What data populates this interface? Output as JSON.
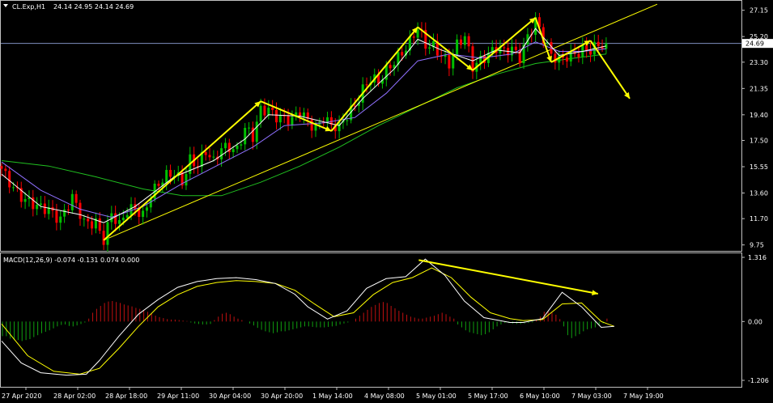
{
  "window": {
    "symbol_label": "CL.Exp,H1",
    "ohlc_label": "24.14 24.95 24.14 24.69",
    "current_price_label": "24.69"
  },
  "colors": {
    "background": "#000000",
    "axis_line": "#c0c0c0",
    "text": "#ffffff",
    "bull_candle": "#00c000",
    "bear_candle": "#ff0000",
    "ema_fast": "#ffffff",
    "ema_slow": "#9070ff",
    "sma_long": "#20c020",
    "trendline": "#ffff00",
    "price_line": "#7f8fbf",
    "macd_line": "#ffffff",
    "signal_line": "#ffff00",
    "hist_pos": "#c01010",
    "hist_neg": "#10a010",
    "annotation": "#ffff00"
  },
  "chart_data": [
    {
      "type": "candlestick",
      "title": "CL.Exp,H1",
      "ylim": [
        9.55,
        27.55
      ],
      "y_ticks": [
        "27.15",
        "25.20",
        "23.30",
        "21.35",
        "19.40",
        "17.50",
        "15.55",
        "13.60",
        "11.70",
        "9.75"
      ],
      "x_ticks": [
        "27 Apr 2020",
        "28 Apr 02:00",
        "28 Apr 18:00",
        "29 Apr 11:00",
        "30 Apr 04:00",
        "30 Apr 20:00",
        "1 May 14:00",
        "4 May 08:00",
        "5 May 01:00",
        "5 May 17:00",
        "6 May 10:00",
        "7 May 03:00",
        "7 May 19:00"
      ],
      "bar_count": 155,
      "last_price": 24.69,
      "close_path": [
        [
          0,
          15.4
        ],
        [
          3,
          14.2
        ],
        [
          6,
          13.0
        ],
        [
          9,
          12.4
        ],
        [
          12,
          12.5
        ],
        [
          15,
          11.8
        ],
        [
          18,
          13.1
        ],
        [
          21,
          11.3
        ],
        [
          24,
          11.6
        ],
        [
          26,
          10.3
        ],
        [
          28,
          12.0
        ],
        [
          30,
          11.0
        ],
        [
          32,
          12.2
        ],
        [
          34,
          12.6
        ],
        [
          36,
          12.1
        ],
        [
          38,
          13.5
        ],
        [
          40,
          14.1
        ],
        [
          42,
          14.7
        ],
        [
          44,
          15.1
        ],
        [
          46,
          14.6
        ],
        [
          48,
          16.2
        ],
        [
          50,
          15.6
        ],
        [
          52,
          16.5
        ],
        [
          54,
          15.8
        ],
        [
          56,
          17.1
        ],
        [
          58,
          17.2
        ],
        [
          60,
          16.8
        ],
        [
          62,
          18.2
        ],
        [
          64,
          17.6
        ],
        [
          66,
          19.8
        ],
        [
          68,
          20.0
        ],
        [
          70,
          19.4
        ],
        [
          72,
          19.0
        ],
        [
          74,
          18.8
        ],
        [
          76,
          19.6
        ],
        [
          78,
          19.1
        ],
        [
          80,
          18.6
        ],
        [
          82,
          19.2
        ],
        [
          84,
          18.4
        ],
        [
          86,
          18.3
        ],
        [
          88,
          19.4
        ],
        [
          90,
          20.3
        ],
        [
          92,
          21.4
        ],
        [
          94,
          22.0
        ],
        [
          96,
          21.6
        ],
        [
          98,
          22.6
        ],
        [
          100,
          23.5
        ],
        [
          102,
          24.2
        ],
        [
          104,
          24.8
        ],
        [
          106,
          25.7
        ],
        [
          108,
          24.4
        ],
        [
          110,
          24.5
        ],
        [
          112,
          24.0
        ],
        [
          114,
          23.3
        ],
        [
          116,
          24.5
        ],
        [
          118,
          25.0
        ],
        [
          120,
          22.9
        ],
        [
          122,
          23.6
        ],
        [
          124,
          24.1
        ],
        [
          126,
          24.4
        ],
        [
          128,
          23.9
        ],
        [
          130,
          24.1
        ],
        [
          132,
          23.7
        ],
        [
          134,
          25.4
        ],
        [
          136,
          26.5
        ],
        [
          138,
          25.0
        ],
        [
          140,
          23.6
        ],
        [
          142,
          23.4
        ],
        [
          144,
          23.9
        ],
        [
          146,
          24.1
        ],
        [
          148,
          24.2
        ],
        [
          150,
          24.0
        ],
        [
          152,
          24.4
        ],
        [
          154,
          24.69
        ]
      ],
      "indicators": [
        {
          "name": "ema_fast",
          "colorKey": "ema_fast",
          "path": [
            [
              0,
              15.0
            ],
            [
              10,
              12.6
            ],
            [
              20,
              12.0
            ],
            [
              26,
              11.4
            ],
            [
              34,
              12.6
            ],
            [
              44,
              14.8
            ],
            [
              54,
              16.0
            ],
            [
              62,
              17.6
            ],
            [
              68,
              19.4
            ],
            [
              76,
              19.3
            ],
            [
              86,
              18.6
            ],
            [
              92,
              20.6
            ],
            [
              100,
              22.8
            ],
            [
              106,
              25.0
            ],
            [
              112,
              24.2
            ],
            [
              120,
              23.4
            ],
            [
              126,
              24.2
            ],
            [
              132,
              24.0
            ],
            [
              136,
              25.8
            ],
            [
              142,
              23.8
            ],
            [
              148,
              24.1
            ],
            [
              154,
              24.5
            ]
          ]
        },
        {
          "name": "ema_slow",
          "colorKey": "ema_slow",
          "path": [
            [
              0,
              15.9
            ],
            [
              10,
              13.8
            ],
            [
              20,
              12.4
            ],
            [
              28,
              11.8
            ],
            [
              36,
              12.6
            ],
            [
              46,
              14.3
            ],
            [
              56,
              15.8
            ],
            [
              64,
              17.0
            ],
            [
              72,
              18.6
            ],
            [
              82,
              18.8
            ],
            [
              90,
              19.2
            ],
            [
              98,
              21.0
            ],
            [
              106,
              23.4
            ],
            [
              114,
              23.9
            ],
            [
              122,
              23.6
            ],
            [
              130,
              23.9
            ],
            [
              136,
              24.8
            ],
            [
              142,
              24.1
            ],
            [
              148,
              24.1
            ],
            [
              154,
              24.3
            ]
          ]
        },
        {
          "name": "sma_long",
          "colorKey": "sma_long",
          "path": [
            [
              0,
              16.0
            ],
            [
              12,
              15.6
            ],
            [
              24,
              14.8
            ],
            [
              36,
              13.9
            ],
            [
              46,
              13.4
            ],
            [
              56,
              13.4
            ],
            [
              66,
              14.4
            ],
            [
              76,
              15.6
            ],
            [
              86,
              17.0
            ],
            [
              96,
              18.6
            ],
            [
              106,
              20.0
            ],
            [
              116,
              21.4
            ],
            [
              126,
              22.4
            ],
            [
              136,
              23.2
            ],
            [
              146,
              23.6
            ],
            [
              154,
              23.9
            ]
          ]
        }
      ],
      "trendlines": [
        {
          "name": "support-trendline",
          "from": [
            26,
            10.1
          ],
          "to": [
            167,
            27.6
          ]
        }
      ],
      "annotations": {
        "zigzag": [
          [
            26,
            10.1
          ],
          [
            66,
            20.4
          ],
          [
            84,
            18.2
          ],
          [
            106,
            25.9
          ],
          [
            120,
            22.7
          ],
          [
            136,
            26.6
          ],
          [
            140,
            23.3
          ],
          [
            150,
            24.9
          ]
        ],
        "projection": {
          "from": [
            150,
            24.9
          ],
          "to": [
            160,
            20.6
          ]
        }
      }
    },
    {
      "type": "macd",
      "title": "MACD(12,26,9) -0.074 -0.131 0.074 0.000",
      "ylim": [
        -1.206,
        1.316
      ],
      "y_ticks": [
        "1.316",
        "0.00",
        "-1.206"
      ],
      "histogram": [
        -0.3,
        -0.3,
        -0.35,
        -0.38,
        -0.38,
        -0.4,
        -0.38,
        -0.36,
        -0.32,
        -0.28,
        -0.24,
        -0.21,
        -0.18,
        -0.14,
        -0.1,
        -0.07,
        -0.06,
        -0.09,
        -0.1,
        -0.08,
        -0.05,
        -0.02,
        0.06,
        0.18,
        0.26,
        0.32,
        0.38,
        0.41,
        0.42,
        0.4,
        0.38,
        0.35,
        0.33,
        0.31,
        0.28,
        0.26,
        0.24,
        0.2,
        0.16,
        0.12,
        0.09,
        0.07,
        0.05,
        0.04,
        0.04,
        0.03,
        0.02,
        0.01,
        -0.02,
        -0.04,
        -0.05,
        -0.06,
        -0.06,
        -0.05,
        0.03,
        0.1,
        0.16,
        0.18,
        0.15,
        0.1,
        0.06,
        0.03,
        0.0,
        -0.04,
        -0.08,
        -0.13,
        -0.17,
        -0.2,
        -0.22,
        -0.24,
        -0.22,
        -0.2,
        -0.2,
        -0.18,
        -0.16,
        -0.14,
        -0.12,
        -0.1,
        -0.1,
        -0.11,
        -0.12,
        -0.12,
        -0.12,
        -0.11,
        -0.1,
        -0.09,
        -0.06,
        -0.04,
        -0.02,
        0.0,
        0.06,
        0.12,
        0.18,
        0.24,
        0.3,
        0.34,
        0.38,
        0.4,
        0.38,
        0.32,
        0.27,
        0.22,
        0.18,
        0.14,
        0.1,
        0.08,
        0.06,
        0.06,
        0.08,
        0.1,
        0.12,
        0.15,
        0.18,
        0.15,
        0.1,
        0.06,
        -0.06,
        -0.12,
        -0.18,
        -0.22,
        -0.24,
        -0.26,
        -0.28,
        -0.26,
        -0.22,
        -0.16,
        -0.1,
        -0.06,
        -0.03,
        -0.03,
        -0.04,
        -0.05,
        -0.05,
        -0.04,
        -0.03,
        -0.02,
        0.03,
        0.1,
        0.2,
        0.22,
        0.18,
        0.14,
        0.05,
        -0.1,
        -0.28,
        -0.34,
        -0.3,
        -0.26,
        -0.2,
        -0.16,
        -0.14,
        -0.12,
        -0.08,
        -0.04,
        0.06
      ],
      "series": [
        {
          "name": "macd",
          "colorKey": "macd_line",
          "path": [
            [
              0,
              -0.4
            ],
            [
              6,
              -0.85
            ],
            [
              12,
              -1.05
            ],
            [
              20,
              -1.1
            ],
            [
              26,
              -1.08
            ],
            [
              30,
              -0.8
            ],
            [
              36,
              -0.3
            ],
            [
              42,
              0.15
            ],
            [
              48,
              0.45
            ],
            [
              54,
              0.7
            ],
            [
              60,
              0.82
            ],
            [
              66,
              0.88
            ],
            [
              72,
              0.9
            ],
            [
              78,
              0.86
            ],
            [
              84,
              0.78
            ],
            [
              90,
              0.56
            ],
            [
              94,
              0.3
            ],
            [
              100,
              0.05
            ],
            [
              106,
              0.22
            ],
            [
              112,
              0.68
            ],
            [
              118,
              0.88
            ],
            [
              124,
              0.92
            ],
            [
              130,
              1.28
            ],
            [
              136,
              0.95
            ],
            [
              142,
              0.42
            ],
            [
              148,
              0.08
            ],
            [
              152,
              0.03
            ],
            [
              156,
              -0.02
            ],
            [
              160,
              -0.02
            ],
            [
              166,
              0.06
            ],
            [
              172,
              0.6
            ],
            [
              178,
              0.3
            ],
            [
              184,
              -0.12
            ],
            [
              188,
              -0.1
            ]
          ]
        },
        {
          "name": "signal",
          "colorKey": "signal_line",
          "path": [
            [
              0,
              -0.05
            ],
            [
              8,
              -0.7
            ],
            [
              16,
              -1.02
            ],
            [
              24,
              -1.08
            ],
            [
              30,
              -0.96
            ],
            [
              36,
              -0.55
            ],
            [
              42,
              -0.1
            ],
            [
              48,
              0.3
            ],
            [
              54,
              0.55
            ],
            [
              60,
              0.72
            ],
            [
              66,
              0.8
            ],
            [
              72,
              0.84
            ],
            [
              78,
              0.82
            ],
            [
              84,
              0.78
            ],
            [
              90,
              0.64
            ],
            [
              96,
              0.36
            ],
            [
              102,
              0.1
            ],
            [
              108,
              0.18
            ],
            [
              114,
              0.55
            ],
            [
              120,
              0.8
            ],
            [
              126,
              0.9
            ],
            [
              132,
              1.1
            ],
            [
              138,
              0.9
            ],
            [
              144,
              0.5
            ],
            [
              150,
              0.18
            ],
            [
              156,
              0.06
            ],
            [
              160,
              0.02
            ],
            [
              166,
              0.04
            ],
            [
              172,
              0.36
            ],
            [
              178,
              0.38
            ],
            [
              184,
              0.0
            ],
            [
              188,
              -0.1
            ]
          ]
        }
      ],
      "annotation": {
        "from": [
          128,
          1.26
        ],
        "to": [
          183,
          0.57
        ]
      }
    }
  ]
}
